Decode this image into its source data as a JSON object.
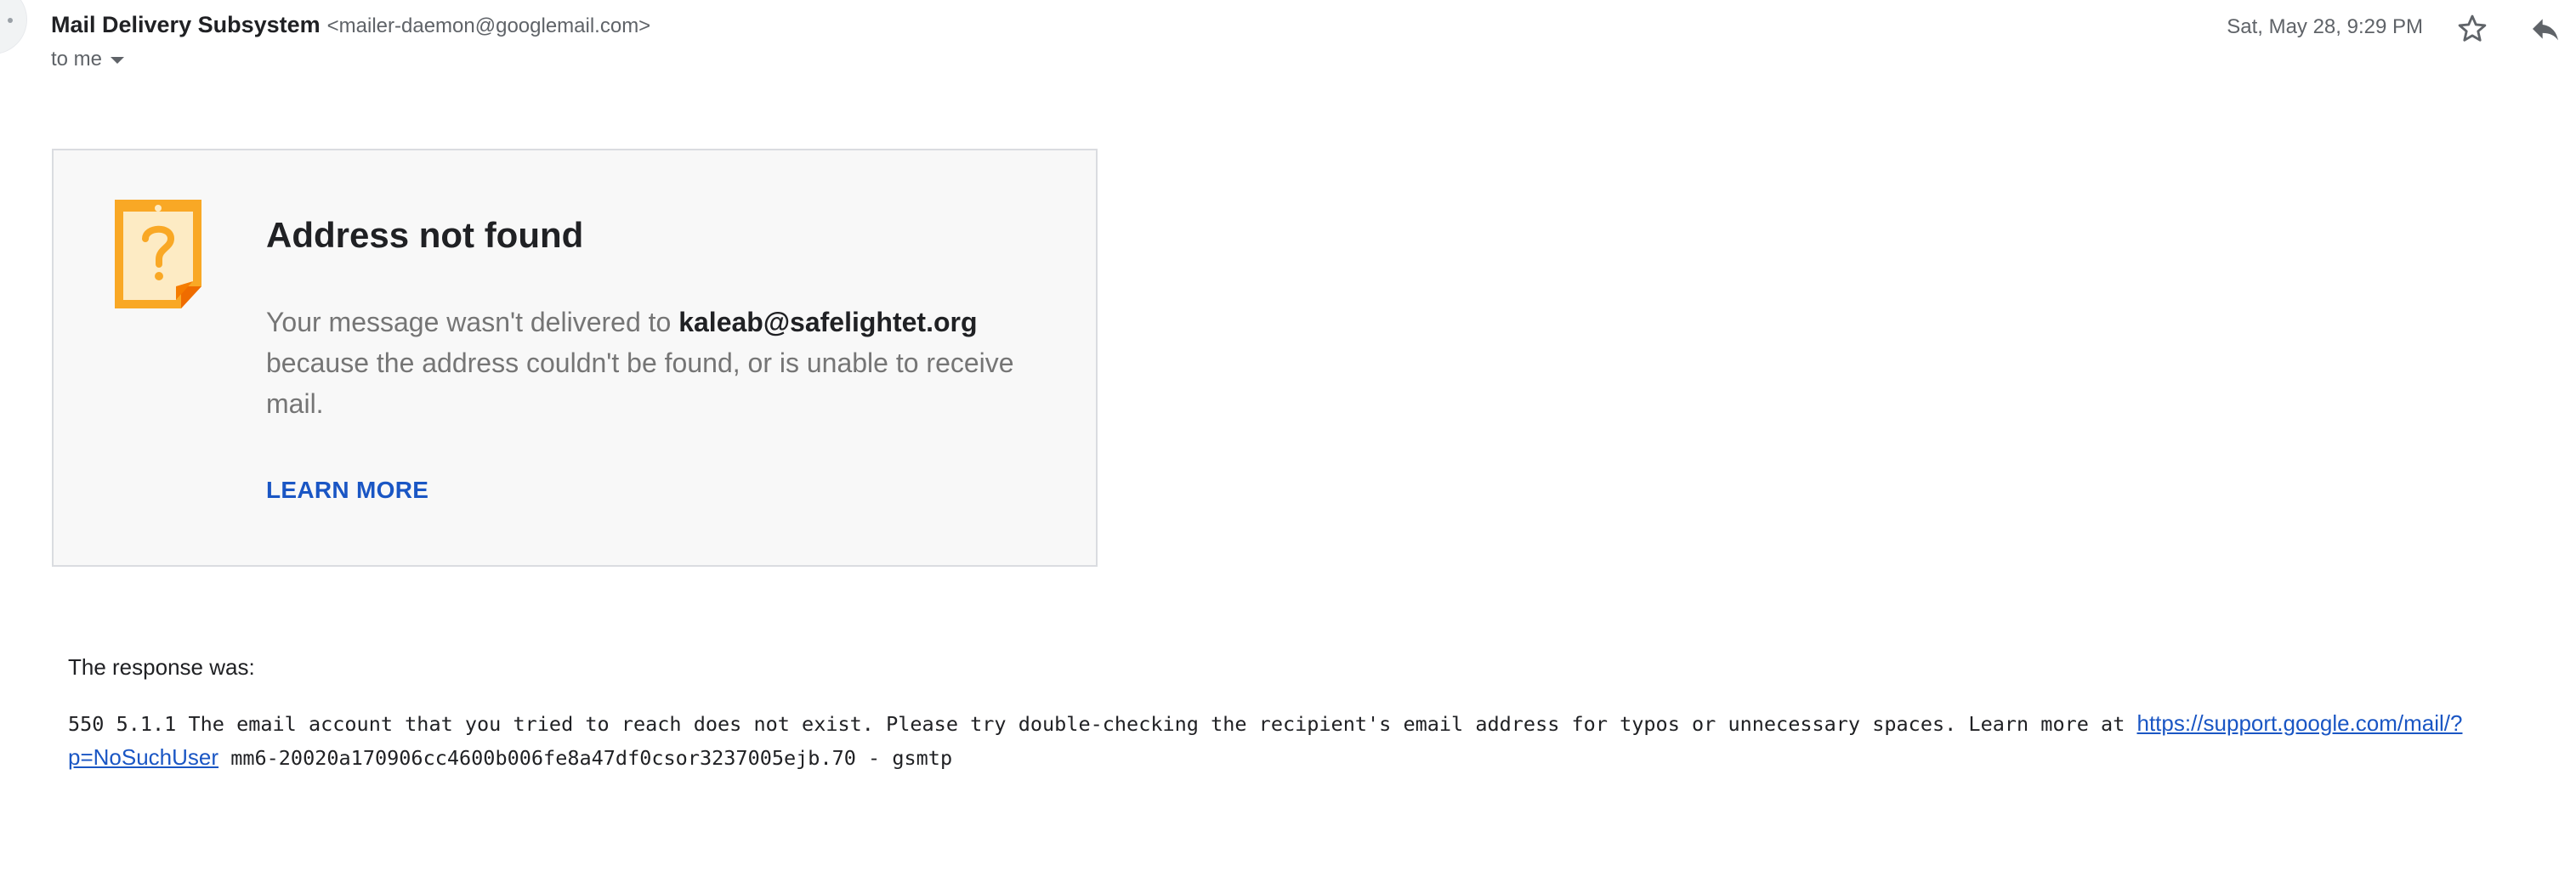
{
  "header": {
    "sender_name": "Mail Delivery Subsystem",
    "sender_email": "<mailer-daemon@googlemail.com>",
    "recipient_label": "to me",
    "timestamp": "Sat, May 28, 9:29 PM",
    "icons": {
      "star": "star-outline-icon",
      "reply": "reply-icon",
      "recipient_dropdown": "caret-down-icon"
    }
  },
  "card": {
    "icon": "question-note-icon",
    "title": "Address not found",
    "message_prefix": "Your message wasn't delivered to ",
    "address": "kaleab@safelightet.org",
    "message_suffix": " because the address couldn't be found, or is unable to receive mail.",
    "learn_more": "LEARN MORE"
  },
  "response": {
    "label": "The response was:",
    "text_before_link": "550 5.1.1 The email account that you tried to reach does not exist. Please try double-checking the recipient's email address for typos or unnecessary spaces. Learn more at ",
    "link": "https://support.google.com/mail/?p=NoSuchUser",
    "text_after_link": " mm6-20020a170906cc4600b006fe8a47df0csor3237005ejb.70 - gsmtp"
  },
  "colors": {
    "accent": "#1a56c4",
    "icon_orange": "#f9a825",
    "muted_text": "#5f6368",
    "card_bg": "#f8f8f8"
  }
}
